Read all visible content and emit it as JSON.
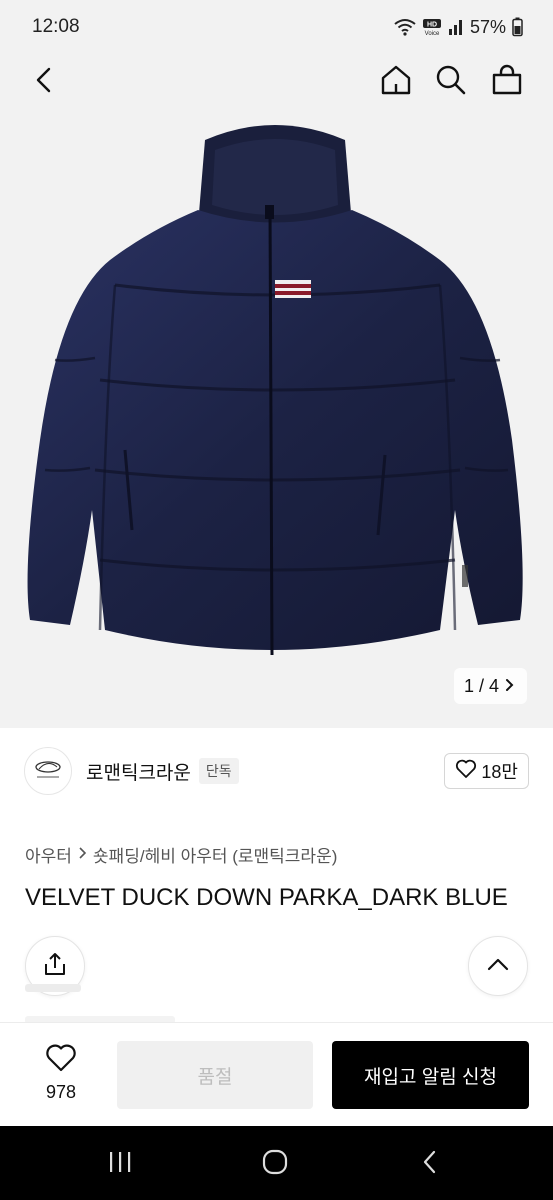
{
  "status": {
    "time": "12:08",
    "battery": "57%",
    "icons": [
      "wifi-icon",
      "hd-voice-icon",
      "signal-icon",
      "battery-icon"
    ]
  },
  "header": {
    "icons": [
      "back-icon",
      "home-icon",
      "search-icon",
      "cart-icon"
    ]
  },
  "gallery": {
    "current": "1",
    "separator": "/",
    "total": "4",
    "counter": "1 / 4"
  },
  "brand": {
    "name": "로맨틱크라운",
    "badge": "단독",
    "likes": "18만"
  },
  "breadcrumb": {
    "category": "아우터",
    "subcategory": "숏패딩/헤비 아우터 (로맨틱크라운)"
  },
  "product": {
    "title": "VELVET DUCK DOWN PARKA_DARK BLUE"
  },
  "actions": {
    "wish_count": "978",
    "soldout_label": "품절",
    "restock_label": "재입고 알림 신청"
  },
  "colors": {
    "accent": "#000000",
    "jacket": "#1c2244"
  }
}
